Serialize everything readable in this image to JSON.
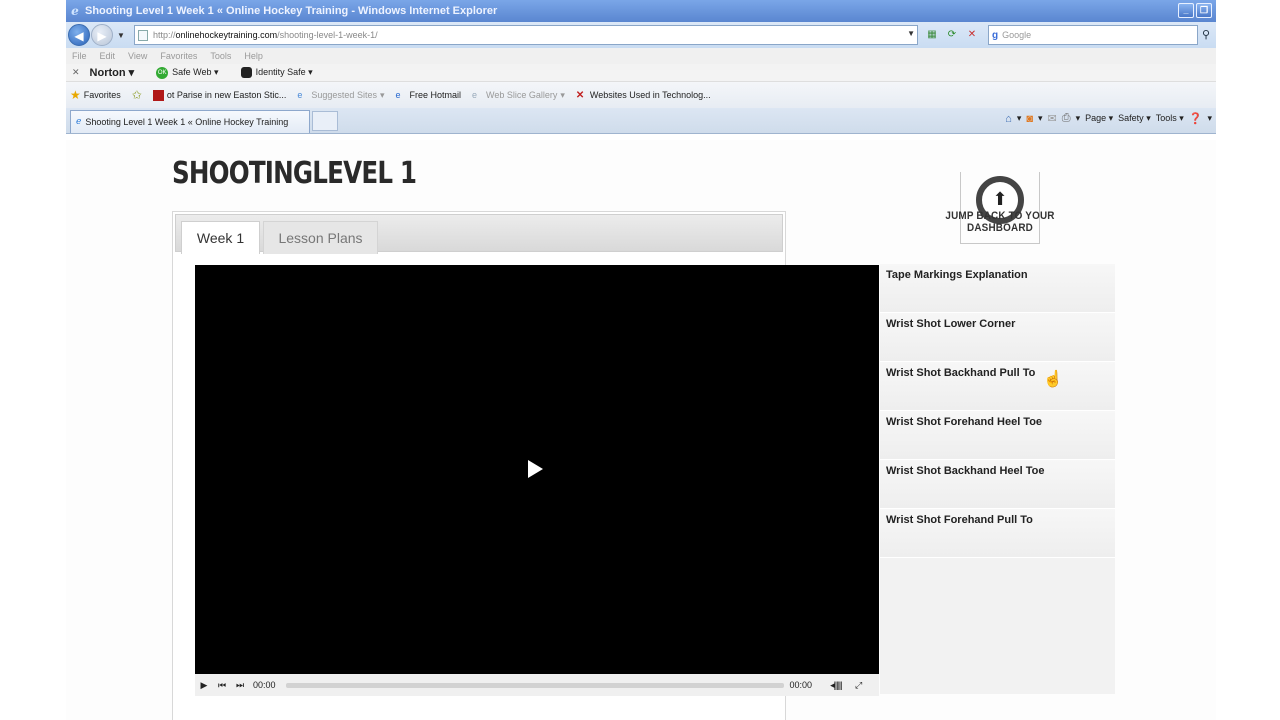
{
  "window": {
    "title": "Shooting Level 1 Week 1 « Online Hockey Training - Windows Internet Explorer"
  },
  "address_bar": {
    "url_prefix": "http://",
    "url_domain": "onlinehockeytraining.com",
    "url_path": "/shooting-level-1-week-1/",
    "search_placeholder": "Google"
  },
  "menu": [
    "File",
    "Edit",
    "View",
    "Favorites",
    "Tools",
    "Help"
  ],
  "norton_bar": {
    "brand": "Norton",
    "safe_web": "Safe Web",
    "identity_safe": "Identity Safe"
  },
  "favorites_bar": {
    "favorites_label": "Favorites",
    "items": [
      "ot Parise in new Easton Stic...",
      "Suggested Sites",
      "Free Hotmail",
      "Web Slice Gallery",
      "Websites Used in Technolog..."
    ]
  },
  "tabs_row": {
    "active_tab": "Shooting Level 1 Week 1 « Online Hockey Training",
    "commands": [
      "Page",
      "Safety",
      "Tools"
    ]
  },
  "page": {
    "title": "SHOOTINGLEVEL 1",
    "dashboard_link": "JUMP BACK TO YOUR DASHBOARD",
    "tabs": [
      "Week 1",
      "Lesson Plans"
    ],
    "video": {
      "current_time": "00:00",
      "total_time": "00:00"
    },
    "playlist": [
      "Tape Markings Explanation",
      "Wrist Shot Lower Corner",
      "Wrist Shot Backhand Pull To",
      "Wrist Shot Forehand Heel Toe",
      "Wrist Shot Backhand Heel Toe",
      "Wrist Shot Forehand Pull To"
    ]
  }
}
